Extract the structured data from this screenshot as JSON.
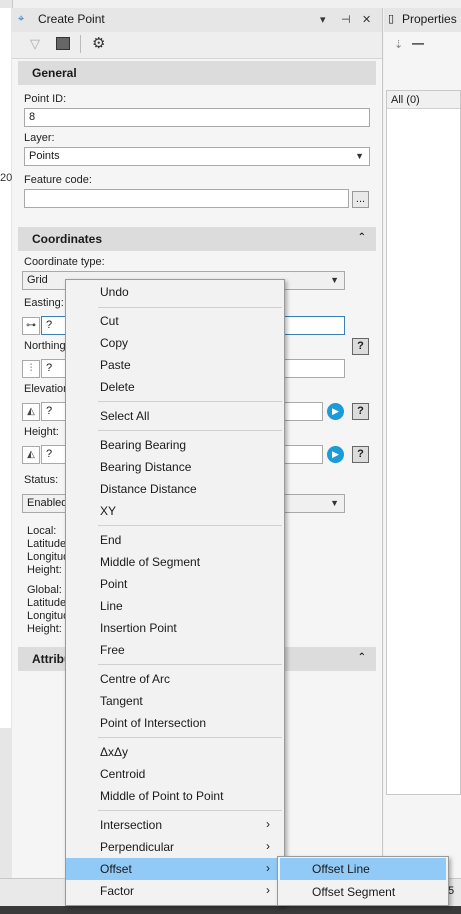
{
  "window": {
    "title": "Create Point",
    "pin_glyph": "▾",
    "pushpin_glyph": "⊣",
    "close_glyph": "✕"
  },
  "right_panel": {
    "title": "Properties",
    "grid_header": "All (0)"
  },
  "left_strip": {
    "partial_number": "20"
  },
  "general": {
    "header": "General",
    "point_id_label": "Point ID:",
    "point_id_value": "8",
    "layer_label": "Layer:",
    "layer_value": "Points",
    "feature_code_label": "Feature code:",
    "feature_code_value": "",
    "browse_label": "..."
  },
  "coordinates": {
    "header": "Coordinates",
    "coord_type_label": "Coordinate type:",
    "coord_type_value": "Grid",
    "easting_label": "Easting:",
    "easting_value": "?",
    "northing_label": "Northing",
    "northing_value": "?",
    "elevation_label": "Elevation",
    "elevation_value": "?",
    "height_label": "Height:",
    "height_value": "?",
    "status_label": "Status:",
    "status_value": "Enabled",
    "local_label": "Local:",
    "global_label": "Global:",
    "latitude_label": "Latitude",
    "longitude_label": "Longitud",
    "height_small_label": "Height:",
    "help_glyph": "?"
  },
  "attributes": {
    "header": "Attribu"
  },
  "context_menu": {
    "items": [
      {
        "label": "Undo"
      },
      {
        "label": "Cut"
      },
      {
        "label": "Copy"
      },
      {
        "label": "Paste"
      },
      {
        "label": "Delete"
      },
      {
        "label": "Select All"
      },
      {
        "label": "Bearing Bearing"
      },
      {
        "label": "Bearing Distance"
      },
      {
        "label": "Distance Distance"
      },
      {
        "label": "XY"
      },
      {
        "label": "End"
      },
      {
        "label": "Middle of Segment"
      },
      {
        "label": "Point"
      },
      {
        "label": "Line"
      },
      {
        "label": "Insertion Point"
      },
      {
        "label": "Free"
      },
      {
        "label": "Centre of Arc"
      },
      {
        "label": "Tangent"
      },
      {
        "label": "Point of Intersection"
      },
      {
        "label": "ΔxΔy"
      },
      {
        "label": "Centroid"
      },
      {
        "label": "Middle of Point to Point"
      },
      {
        "label": "Intersection"
      },
      {
        "label": "Perpendicular"
      },
      {
        "label": "Offset"
      },
      {
        "label": "Factor"
      }
    ],
    "submenu_arrow": "›"
  },
  "offset_submenu": {
    "items": [
      {
        "label": "Offset Line"
      },
      {
        "label": "Offset Segment"
      }
    ]
  },
  "bottom": {
    "partial_digit": "5"
  },
  "colors": {
    "highlight": "#91c9f7",
    "accent_blue": "#1b9bd7",
    "section_header": "#dcdcdc"
  }
}
